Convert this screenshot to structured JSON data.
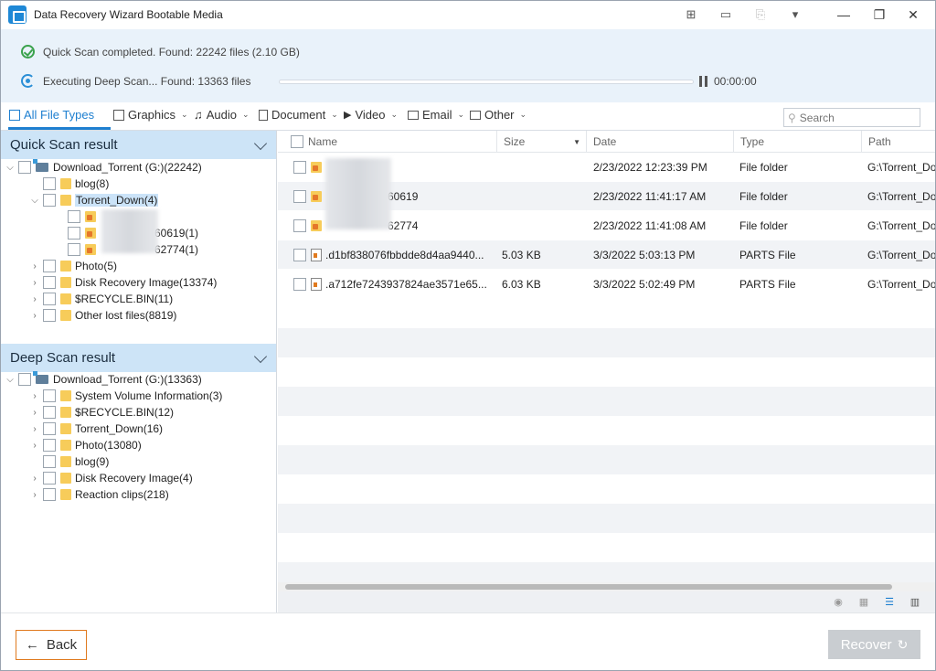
{
  "window": {
    "title": "Data Recovery Wizard Bootable Media"
  },
  "status": {
    "quick_scan": "Quick Scan completed.  Found: 22242 files (2.10 GB)",
    "deep_scan": "Executing Deep Scan... Found: 13363 files",
    "progress": 0.0,
    "timer": "00:00:00"
  },
  "filters": {
    "tabs": [
      {
        "label": "All File Types",
        "icon": "monitor-icon",
        "active": true
      },
      {
        "label": "Graphics",
        "icon": "image-icon"
      },
      {
        "label": "Audio",
        "icon": "music-icon"
      },
      {
        "label": "Document",
        "icon": "document-icon"
      },
      {
        "label": "Video",
        "icon": "video-icon"
      },
      {
        "label": "Email",
        "icon": "mail-icon"
      },
      {
        "label": "Other",
        "icon": "folder-icon"
      }
    ],
    "search_placeholder": "Search"
  },
  "quick_scan_tree": {
    "title": "Quick Scan result",
    "nodes": [
      {
        "label": "Download_Torrent (G:)(22242)"
      },
      {
        "label": "blog(8)"
      },
      {
        "label": "Torrent_Down(4)"
      },
      {
        "label": "60619(1)"
      },
      {
        "label": "62774(1)"
      },
      {
        "label": "Photo(5)"
      },
      {
        "label": "Disk Recovery Image(13374)"
      },
      {
        "label": "$RECYCLE.BIN(11)"
      },
      {
        "label": "Other lost files(8819)"
      }
    ]
  },
  "deep_scan_tree": {
    "title": "Deep Scan result",
    "nodes": [
      {
        "label": "Download_Torrent (G:)(13363)"
      },
      {
        "label": "System Volume Information(3)"
      },
      {
        "label": "$RECYCLE.BIN(12)"
      },
      {
        "label": "Torrent_Down(16)"
      },
      {
        "label": "Photo(13080)"
      },
      {
        "label": "blog(9)"
      },
      {
        "label": "Disk Recovery Image(4)"
      },
      {
        "label": "Reaction clips(218)"
      }
    ]
  },
  "table": {
    "columns": [
      "Name",
      "Size",
      "Date",
      "Type",
      "Path"
    ],
    "rows": [
      {
        "name": "",
        "size": "",
        "date": "2/23/2022 12:23:39 PM",
        "type": "File folder",
        "path": "G:\\Torrent_Do"
      },
      {
        "name": "60619",
        "size": "",
        "date": "2/23/2022 11:41:17 AM",
        "type": "File folder",
        "path": "G:\\Torrent_Do"
      },
      {
        "name": "62774",
        "size": "",
        "date": "2/23/2022 11:41:08 AM",
        "type": "File folder",
        "path": "G:\\Torrent_Do"
      },
      {
        "name": ".d1bf838076fbbdde8d4aa9440...",
        "size": "5.03 KB",
        "date": "3/3/2022 5:03:13 PM",
        "type": "PARTS File",
        "path": "G:\\Torrent_Do"
      },
      {
        "name": ".a712fe7243937824ae3571e65...",
        "size": "6.03 KB",
        "date": "3/3/2022 5:02:49 PM",
        "type": "PARTS File",
        "path": "G:\\Torrent_Do"
      }
    ]
  },
  "footer": {
    "back_label": "Back",
    "recover_label": "Recover"
  }
}
